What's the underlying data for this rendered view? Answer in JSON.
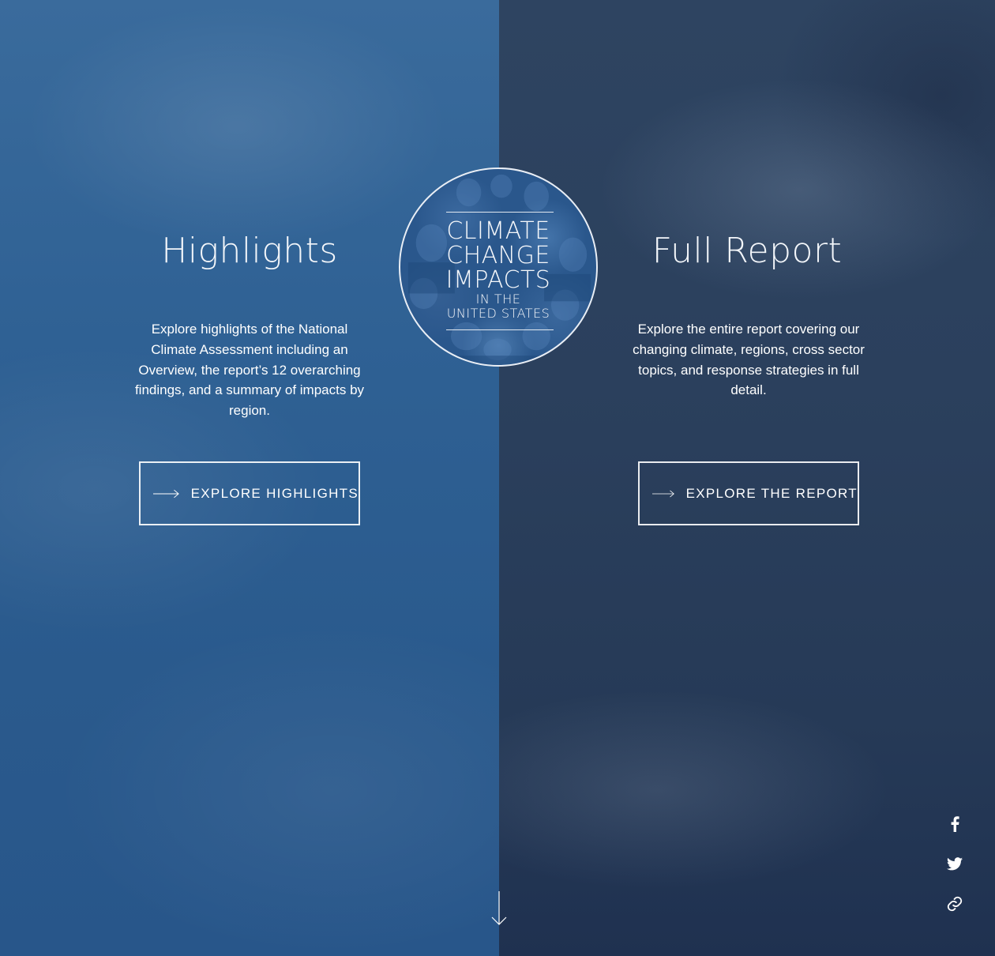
{
  "left_panel": {
    "heading": "Highlights",
    "description": "Explore highlights of the National Climate Assessment including an Overview, the report’s 12 overarching findings, and a summary of impacts by region.",
    "button_label": "EXPLORE HIGHLIGHTS"
  },
  "right_panel": {
    "heading": "Full Report",
    "description": "Explore the entire report covering our changing climate, regions, cross sector topics, and response strategies in full detail.",
    "button_label": "EXPLORE THE REPORT"
  },
  "logo": {
    "line1": "CLIMATE",
    "line2": "CHANGE",
    "line3": "IMPACTS",
    "line4": "IN THE",
    "line5": "UNITED STATES"
  },
  "icons": {
    "scroll": "arrow-down-icon",
    "facebook": "facebook-icon",
    "twitter": "twitter-icon",
    "link": "link-icon"
  },
  "colors": {
    "left_panel": "#2f6194",
    "right_panel": "#2b405d",
    "text": "#ffffff"
  }
}
